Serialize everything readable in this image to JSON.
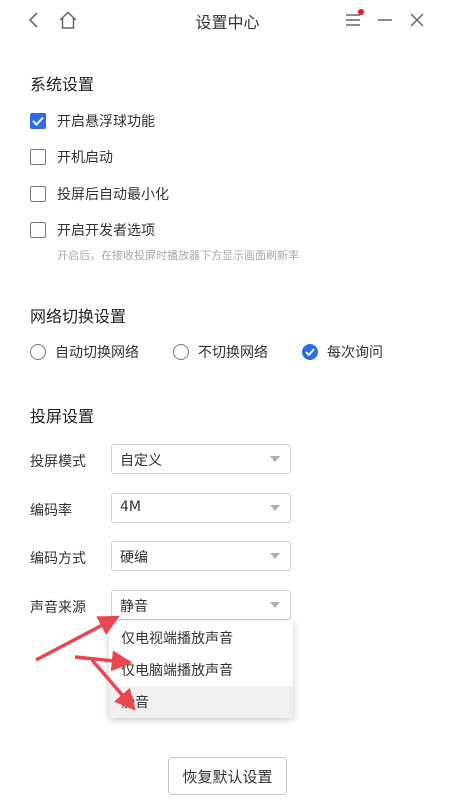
{
  "window": {
    "title": "设置中心",
    "notification_dot_color": "#e0202b"
  },
  "system": {
    "heading": "系统设置",
    "options": [
      {
        "label": "开启悬浮球功能",
        "checked": true
      },
      {
        "label": "开机启动",
        "checked": false
      },
      {
        "label": "投屏后自动最小化",
        "checked": false
      },
      {
        "label": "开启开发者选项",
        "checked": false
      }
    ],
    "developer_hint": "开启后，在接收投屏时播放器下方显示画面刷新率"
  },
  "network": {
    "heading": "网络切换设置",
    "options": [
      {
        "label": "自动切换网络",
        "checked": false
      },
      {
        "label": "不切换网络",
        "checked": false
      },
      {
        "label": "每次询问",
        "checked": true
      }
    ]
  },
  "cast": {
    "heading": "投屏设置",
    "fields": [
      {
        "label": "投屏模式",
        "value": "自定义"
      },
      {
        "label": "编码率",
        "value": "4M"
      },
      {
        "label": "编码方式",
        "value": "硬编"
      },
      {
        "label": "声音来源",
        "value": "静音"
      }
    ],
    "audio_dropdown": {
      "options": [
        "仅电视端播放声音",
        "仅电脑端播放声音",
        "静音"
      ],
      "selected": "静音"
    }
  },
  "footer": {
    "reset_label": "恢复默认设置"
  },
  "colors": {
    "accent": "#2b6de3",
    "annotation_arrow": "#e8474f"
  }
}
